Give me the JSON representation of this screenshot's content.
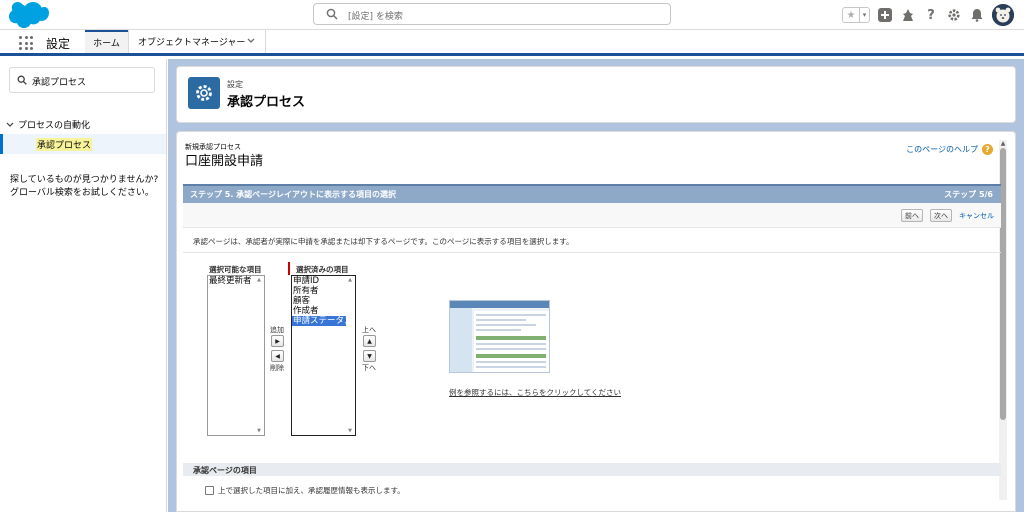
{
  "header": {
    "search_placeholder": "[設定] を検索",
    "icons": [
      "favorites-star-icon",
      "add-icon",
      "trailhead-icon",
      "help-icon",
      "setup-gear-icon",
      "notifications-bell-icon",
      "avatar"
    ]
  },
  "nav": {
    "app_name": "設定",
    "tabs": [
      {
        "label": "ホーム"
      },
      {
        "label": "オブジェクトマネージャー"
      }
    ]
  },
  "sidebar": {
    "quick_find_value": "承認プロセス",
    "tree_parent": "プロセスの自動化",
    "tree_child": "承認プロセス",
    "not_found_text": "探しているものが見つかりませんか? グローバル検索をお試しください。"
  },
  "page_header": {
    "subtitle": "設定",
    "title": "承認プロセス"
  },
  "wizard": {
    "subtitle": "新規承認プロセス",
    "title": "口座開設申請",
    "help_link": "このページのヘルプ",
    "step_title": "ステップ 5. 承認ページレイアウトに表示する項目の選択",
    "step_count": "ステップ 5/6",
    "prev_label": "前へ",
    "next_label": "次へ",
    "cancel_label": "キャンセル",
    "description": "承認ページは、承認者が実際に申請を承認または却下するページです。このページに表示する項目を選択します。",
    "available_label": "選択可能な項目",
    "selected_label": "選択済みの項目",
    "available_items": [
      "最終更新者"
    ],
    "selected_items": [
      "申請ID",
      "所有者",
      "顧客",
      "作成者",
      "申請ステータス"
    ],
    "selected_highlight_index": 4,
    "add_label": "追加",
    "remove_label": "削除",
    "up_label": "上へ",
    "down_label": "下へ",
    "preview_link": "例を参照するには、こちらをクリックしてください",
    "section2_title": "承認ページの項目",
    "checkbox_label": "上で選択した項目に加え、承認履歴情報も表示します。",
    "checkbox_checked": false
  },
  "colors": {
    "brand_blue": "#1b5297",
    "step_bar": "#8ea9c8",
    "selection": "#3875d7",
    "page_bg": "#b0c4df"
  }
}
